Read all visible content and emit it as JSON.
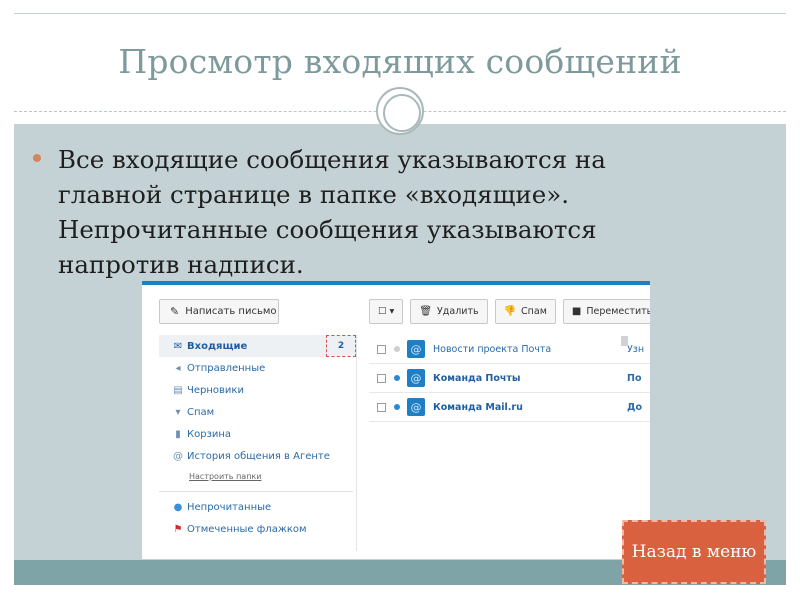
{
  "slide": {
    "title": "Просмотр входящих сообщений",
    "bullet_lines": [
      "Все входящие сообщения указываются на",
      "главной странице в папке «входящие».",
      "Непрочитанные сообщения указываются",
      "напротив надписи."
    ],
    "back_button": "Назад в меню",
    "colors": {
      "title": "#7f9a9c",
      "content_bg": "#c5d2d5",
      "bottom_bar": "#7ea4a7",
      "bullet": "#d0875a",
      "button": "#d9613f",
      "mail_accent": "#1a80c7"
    }
  },
  "mail": {
    "compose_label": "Написать письмо",
    "compose_icon": "pencil-icon",
    "folders": [
      {
        "label": "Входящие",
        "icon": "envelope-icon",
        "count": "2",
        "active": true
      },
      {
        "label": "Отправленные",
        "icon": "reply-arrow-icon"
      },
      {
        "label": "Черновики",
        "icon": "document-icon"
      },
      {
        "label": "Спам",
        "icon": "thumbs-down-icon"
      },
      {
        "label": "Корзина",
        "icon": "trash-icon"
      },
      {
        "label": "История общения в Агенте",
        "icon": "at-sign-icon"
      }
    ],
    "setup_folders": "Настроить папки",
    "filters": [
      {
        "label": "Непрочитанные",
        "icon": "unread-dot-icon"
      },
      {
        "label": "Отмеченные флажком",
        "icon": "flag-icon"
      }
    ],
    "toolbar": {
      "select_icon": "checkbox-dropdown-icon",
      "delete": "Удалить",
      "spam": "Спам",
      "move": "Переместить"
    },
    "messages": [
      {
        "sender": "Новости проекта Почта",
        "subject": "Узн",
        "unread": false
      },
      {
        "sender": "Команда Почты",
        "subject": "По",
        "unread": true
      },
      {
        "sender": "Команда Mail.ru",
        "subject": "До",
        "unread": true
      }
    ]
  }
}
